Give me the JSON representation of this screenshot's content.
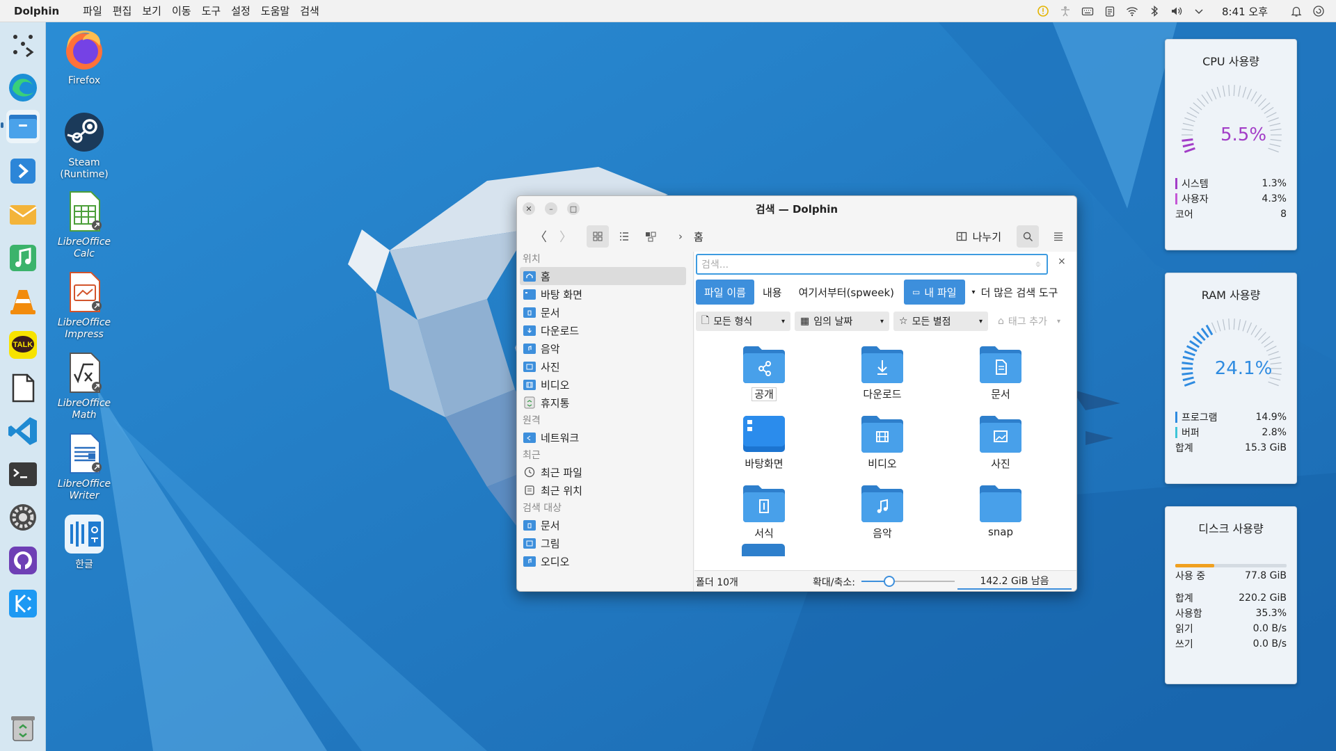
{
  "topbar": {
    "app_name": "Dolphin",
    "menu": [
      "파일",
      "편집",
      "보기",
      "이동",
      "도구",
      "설정",
      "도움말",
      "검색"
    ],
    "clock": "8:41 오후"
  },
  "desktop_icons": [
    {
      "label": "Firefox"
    },
    {
      "label": "Steam\n(Runtime)"
    },
    {
      "label": "LibreOffice Calc"
    },
    {
      "label": "LibreOffice Impress"
    },
    {
      "label": "LibreOffice Math"
    },
    {
      "label": "LibreOffice Writer"
    },
    {
      "label": "한글"
    }
  ],
  "dock_icons": [
    "app-grid-icon",
    "edge-icon",
    "files-icon",
    "remote-icon",
    "mail-icon",
    "music-icon",
    "vlc-icon",
    "kakaotalk-icon",
    "document-icon",
    "vscode-icon",
    "terminal-icon",
    "settings-icon",
    "github-icon",
    "kde-icon",
    "trash-icon"
  ],
  "dock_kakao_label": "TALK",
  "widgets": {
    "cpu": {
      "title": "CPU 사용량",
      "value": "5.5%",
      "fraction": 0.055,
      "color": "#a23dc7",
      "rows": [
        {
          "k": "시스템",
          "v": "1.3%",
          "color": "#a23dc7"
        },
        {
          "k": "사용자",
          "v": "4.3%",
          "color": "#c457d6"
        },
        {
          "k": "코어",
          "v": "8",
          "color": ""
        }
      ]
    },
    "ram": {
      "title": "RAM 사용량",
      "value": "24.1%",
      "fraction": 0.241,
      "color": "#2f8be0",
      "rows": [
        {
          "k": "프로그램",
          "v": "14.9%",
          "color": "#2f8be0"
        },
        {
          "k": "버퍼",
          "v": "2.8%",
          "color": "#3ec5d8"
        },
        {
          "k": "합계",
          "v": "15.3 GiB",
          "color": ""
        }
      ]
    },
    "disk": {
      "title": "디스크 사용량",
      "used_fraction": 0.353,
      "rows": [
        {
          "k": "사용 중",
          "v": "77.8 GiB"
        },
        {
          "k": "합계",
          "v": "220.2 GiB"
        },
        {
          "k": "사용함",
          "v": "35.3%"
        },
        {
          "k": "읽기",
          "v": "0.0 B/s"
        },
        {
          "k": "쓰기",
          "v": "0.0 B/s"
        }
      ]
    }
  },
  "window": {
    "title": "검색 — Dolphin",
    "breadcrumb": "홈",
    "split_label": "나누기",
    "search_placeholder": "검색...",
    "search_close": "×",
    "chips": [
      "파일 이름",
      "내용",
      "여기서부터(spweek)",
      "내 파일",
      "더 많은 검색 도구"
    ],
    "filters": [
      "모든 형식",
      "임의 날짜",
      "모든 별점",
      "태그 추가"
    ],
    "places": {
      "sections": {
        "places": "위치",
        "remote": "원격",
        "recent": "최근",
        "search": "검색 대상"
      },
      "places_items": [
        "홈",
        "바탕 화면",
        "문서",
        "다운로드",
        "음악",
        "사진",
        "비디오",
        "휴지통"
      ],
      "remote_items": [
        "네트워크"
      ],
      "recent_items": [
        "최근 파일",
        "최근 위치"
      ],
      "search_items": [
        "문서",
        "그림",
        "오디오"
      ]
    },
    "folders": [
      "공개",
      "다운로드",
      "문서",
      "바탕화면",
      "비디오",
      "사진",
      "서식",
      "음악",
      "snap"
    ],
    "status": {
      "folder_count": "폴더 10개",
      "zoom_label": "확대/축소:",
      "zoom_fraction": 0.3,
      "free_space": "142.2 GiB 남음"
    }
  }
}
